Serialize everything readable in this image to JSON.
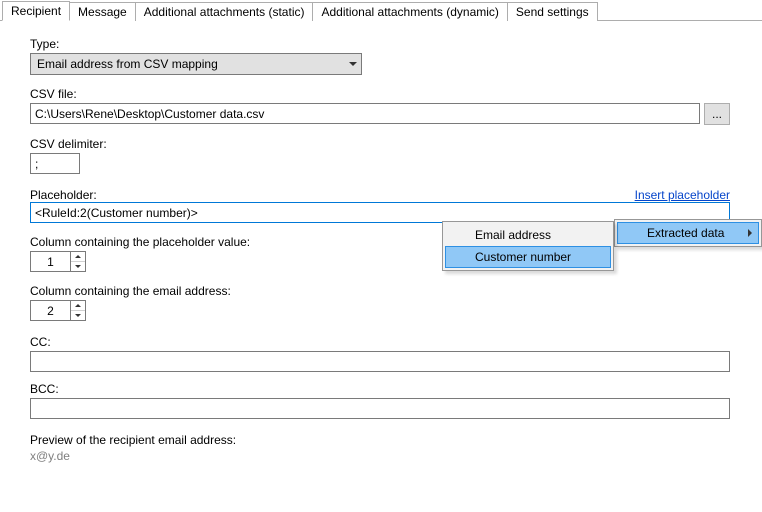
{
  "tabs": {
    "t0": "Recipient",
    "t1": "Message",
    "t2": "Additional attachments (static)",
    "t3": "Additional attachments (dynamic)",
    "t4": "Send settings"
  },
  "labels": {
    "type": "Type:",
    "csv_file": "CSV file:",
    "csv_delim": "CSV delimiter:",
    "placeholder": "Placeholder:",
    "insert_placeholder": "Insert placeholder",
    "col_placeholder": "Column containing the placeholder value:",
    "col_email": "Column containing the email address:",
    "cc": "CC:",
    "bcc": "BCC:",
    "preview": "Preview of the recipient email address:"
  },
  "values": {
    "type": "Email address from CSV mapping",
    "csv_file": "C:\\Users\\Rene\\Desktop\\Customer data.csv",
    "browse_btn": "...",
    "csv_delim": ";",
    "placeholder": "<RuleId:2(Customer number)>",
    "col_placeholder": "1",
    "col_email": "2",
    "cc": "",
    "bcc": "",
    "preview": "x@y.de"
  },
  "menu": {
    "parent0": "Extracted data",
    "child0": "Email address",
    "child1": "Customer number"
  }
}
